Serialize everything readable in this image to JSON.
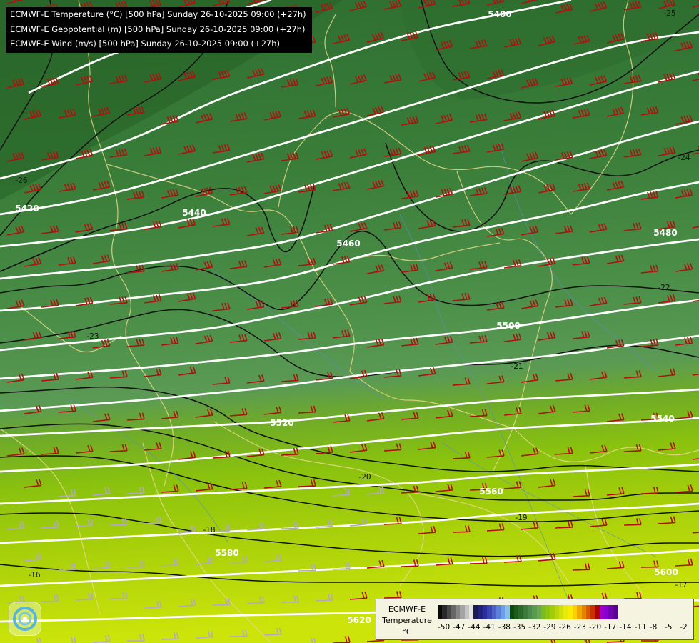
{
  "titles": [
    "ECMWF-E Temperature (°C) [500 hPa] Sunday 26-10-2025 09:00 (+27h)",
    "ECMWF-E Geopotential (m) [500 hPa] Sunday 26-10-2025 09:00 (+27h)",
    "ECMWF-E Wind (m/s) [500 hPa] Sunday 26-10-2025 09:00 (+27h)"
  ],
  "legend": {
    "model": "ECMWF-E",
    "variable": "Temperature",
    "unit": "°C",
    "ticks": [
      "-50",
      "-47",
      "-44",
      "-41",
      "-38",
      "-35",
      "-32",
      "-29",
      "-26",
      "-23",
      "-20",
      "-17",
      "-14",
      "-11",
      "-8",
      "-5",
      "-2"
    ],
    "colors": [
      "#0a0a0a",
      "#282828",
      "#474747",
      "#666666",
      "#858585",
      "#a4a4a4",
      "#c4c4c4",
      "#e3e3e3",
      "#1a1a5a",
      "#22227a",
      "#2a2e9a",
      "#3a46b4",
      "#4a62c8",
      "#5a80d8",
      "#6ca0e4",
      "#86bcee",
      "#0e4a0e",
      "#1c5a1c",
      "#2a6a2a",
      "#3a7a3a",
      "#4a8a4a",
      "#5a9a52",
      "#6aa852",
      "#7aba2a",
      "#8ac40e",
      "#a2cc0a",
      "#bad60a",
      "#d2e00a",
      "#e8ea0a",
      "#f8ec00",
      "#f8d000",
      "#f0a800",
      "#e88000",
      "#d85800",
      "#c83000",
      "#b00000",
      "#a000c0",
      "#8a00d0",
      "#7000b0",
      "#5a0090"
    ]
  },
  "contour_labels": {
    "geopotential": [
      "5400",
      "5420",
      "5440",
      "5460",
      "5480",
      "5500",
      "5520",
      "5540",
      "5560",
      "5580",
      "5600",
      "5620"
    ],
    "temperature": [
      "-25",
      "-26",
      "-24",
      "-22",
      "-23",
      "-21",
      "-20",
      "-19",
      "-18",
      "-16",
      "-17"
    ]
  }
}
